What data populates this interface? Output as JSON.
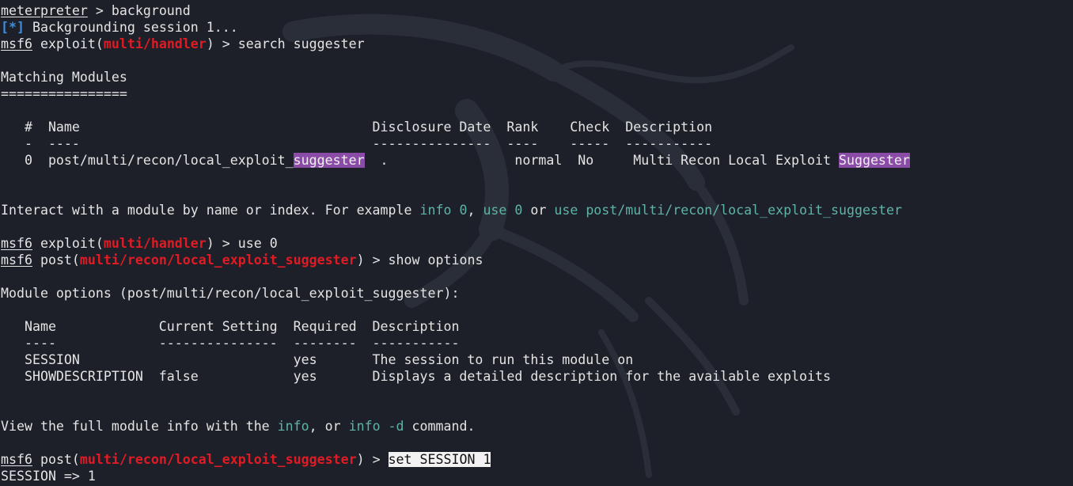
{
  "terminal": {
    "colors": {
      "background": "#1d2029",
      "foreground": "#e4e4e4",
      "module_red": "#e01b24",
      "status_blue": "#3d8fe0",
      "command_teal": "#5fb3a3",
      "search_highlight": "#8b4ca8"
    },
    "background_graphic": "dragon-logo-watermark",
    "l1": {
      "prompt": "meterpreter",
      "rest": " > background"
    },
    "l2": {
      "marker": "[*]",
      "rest": " Backgrounding session 1..."
    },
    "l3": {
      "prompt": "msf6",
      "pre": " exploit(",
      "module": "multi/handler",
      "rest": ") > search suggester"
    },
    "l5": "Matching Modules",
    "l6": "================",
    "l8": "   #  Name                                     Disclosure Date  Rank    Check  Description",
    "l9": "   -  ----                                     ---------------  ----    -----  -----------",
    "l10": {
      "a": "   0  post/multi/recon/local_exploit_",
      "h1": "suggester",
      "b": "  .                normal  No     Multi Recon Local Exploit ",
      "h2": "Suggester"
    },
    "l13": {
      "a": "Interact with a module by name or index. For example ",
      "c1": "info 0",
      "b": ", ",
      "c2": "use 0",
      "c": " or ",
      "c3": "use post/multi/recon/local_exploit_suggester"
    },
    "l15": {
      "prompt": "msf6",
      "pre": " exploit(",
      "module": "multi/handler",
      "rest": ") > use 0"
    },
    "l16": {
      "prompt": "msf6",
      "pre": " post(",
      "module": "multi/recon/local_exploit_suggester",
      "rest": ") > show options"
    },
    "l18": "Module options (post/multi/recon/local_exploit_suggester):",
    "l20": "   Name             Current Setting  Required  Description",
    "l21": "   ----             ---------------  --------  -----------",
    "l22": "   SESSION                           yes       The session to run this module on",
    "l23": "   SHOWDESCRIPTION  false            yes       Displays a detailed description for the available exploits",
    "l26": {
      "a": "View the full module info with the ",
      "c1": "info",
      "b": ", or ",
      "c2": "info -d",
      "c": " command."
    },
    "l28": {
      "prompt": "msf6",
      "pre": " post(",
      "module": "multi/recon/local_exploit_suggester",
      "rest": ") > ",
      "input": "set SESSION 1"
    },
    "l29": "SESSION => 1"
  }
}
